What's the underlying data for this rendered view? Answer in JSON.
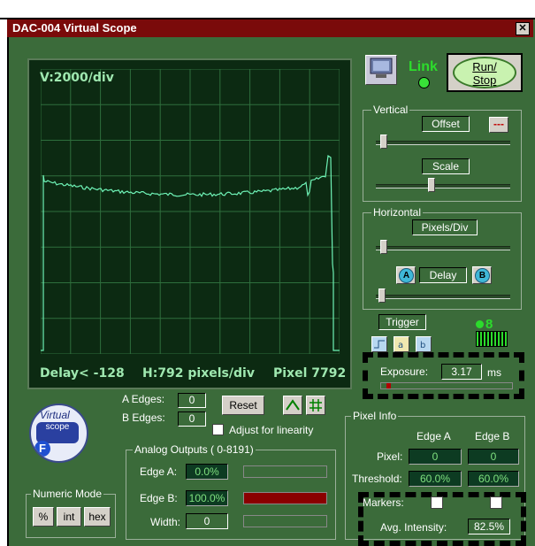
{
  "window": {
    "title": "DAC-004 Virtual Scope",
    "close_glyph": "✕"
  },
  "scope": {
    "volts_label": "V:2000/div",
    "delay_label": "Delay< -128",
    "h_label": "H:792 pixels/div",
    "pixel_label": "Pixel 7792",
    "trace_color": "#6ef2b6",
    "grid_color": "#2e6e3c"
  },
  "header": {
    "link_label": "Link",
    "run_stop_line1": "Run/",
    "run_stop_line2": "Stop"
  },
  "vertical": {
    "title": "Vertical",
    "offset_label": "Offset",
    "offset_btn": "---",
    "scale_label": "Scale"
  },
  "horizontal": {
    "title": "Horizontal",
    "pixels_div_label": "Pixels/Div",
    "delay_label": "Delay",
    "a_btn": "A",
    "b_btn": "B"
  },
  "trigger": {
    "label": "Trigger",
    "count": "8"
  },
  "exposure": {
    "label": "Exposure:",
    "value": "3.17",
    "unit": "ms"
  },
  "edges": {
    "a_label": "A Edges:",
    "a_value": "0",
    "b_label": "B Edges:",
    "b_value": "0",
    "reset_label": "Reset",
    "adjust_label": "Adjust for linearity"
  },
  "analog": {
    "title": "Analog Outputs ( 0-8191)",
    "edge_a_label": "Edge A:",
    "edge_a_value": "0.0%",
    "edge_a_fraction": 0.0,
    "edge_b_label": "Edge B:",
    "edge_b_value": "100.0%",
    "edge_b_fraction": 1.0,
    "width_label": "Width:",
    "width_value": "0"
  },
  "numeric_mode": {
    "title": "Numeric Mode",
    "pct": "%",
    "int": "int",
    "hex": "hex"
  },
  "logo": {
    "line1": "Virtual",
    "line2": "scope",
    "badge": "F"
  },
  "pixel_info": {
    "title": "Pixel Info",
    "edge_a_header": "Edge A",
    "edge_b_header": "Edge B",
    "pixel_label": "Pixel:",
    "pixel_a": "0",
    "pixel_b": "0",
    "threshold_label": "Threshold:",
    "threshold_a": "60.0%",
    "threshold_b": "60.0%",
    "markers_label": "Markers:",
    "avg_label": "Avg. Intensity:",
    "avg_value": "82.5%"
  }
}
